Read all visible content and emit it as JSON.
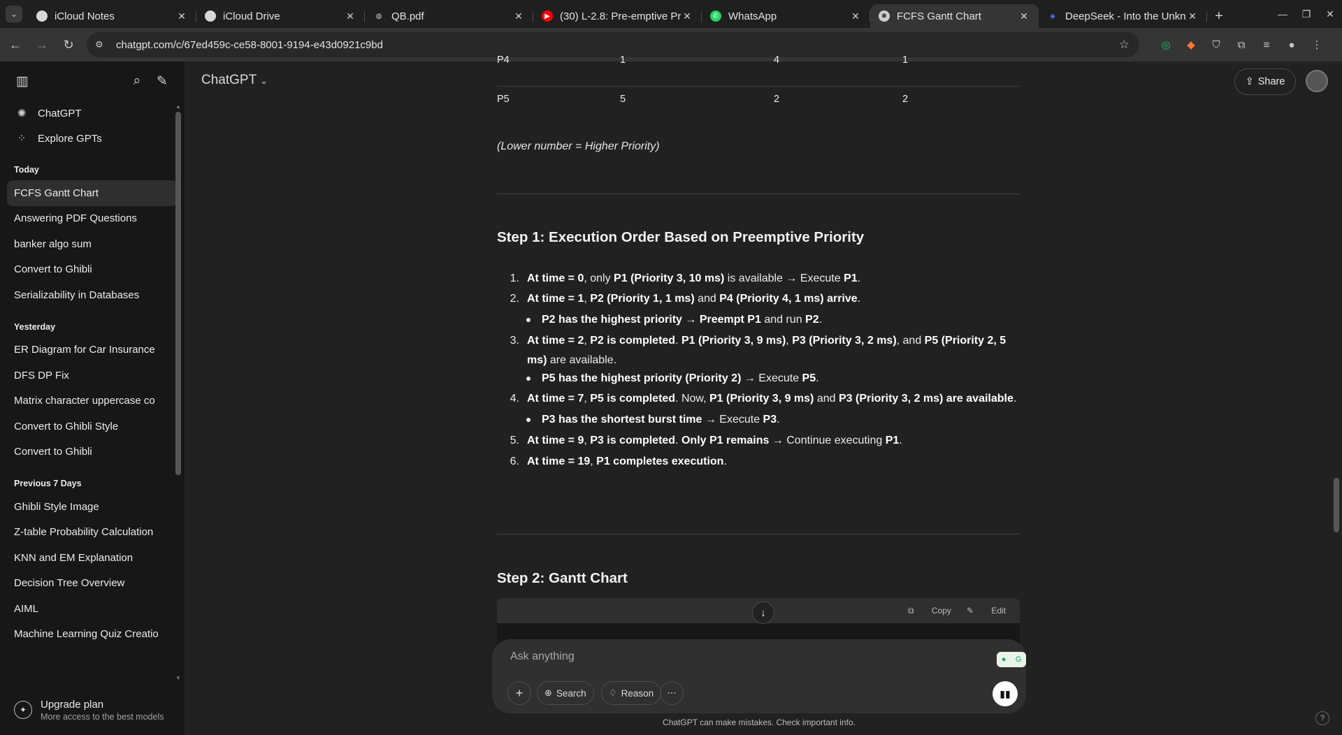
{
  "browser": {
    "tabs": [
      {
        "title": "iCloud Notes",
        "icon": "apple-icon",
        "active": false
      },
      {
        "title": "iCloud Drive",
        "icon": "apple-icon",
        "active": false
      },
      {
        "title": "QB.pdf",
        "icon": "globe-icon",
        "active": false
      },
      {
        "title": "(30) L-2.8: Pre-emptive Pr",
        "icon": "youtube-icon",
        "active": false
      },
      {
        "title": "WhatsApp",
        "icon": "whatsapp-icon",
        "active": false
      },
      {
        "title": "FCFS Gantt Chart",
        "icon": "chatgpt-icon",
        "active": true
      },
      {
        "title": "DeepSeek - Into the Unkn",
        "icon": "deepseek-icon",
        "active": false
      }
    ],
    "url": "chatgpt.com/c/67ed459c-ce58-8001-9194-e43d0921c9bd"
  },
  "sidebar": {
    "top_items": [
      {
        "label": "ChatGPT",
        "icon": "chatgpt-icon"
      },
      {
        "label": "Explore GPTs",
        "icon": "grid-icon"
      }
    ],
    "sections": [
      {
        "title": "Today",
        "items": [
          "FCFS Gantt Chart",
          "Answering PDF Questions",
          "banker algo sum",
          "Convert to Ghibli",
          "Serializability in Databases"
        ]
      },
      {
        "title": "Yesterday",
        "items": [
          "ER Diagram for Car Insurance",
          "DFS DP Fix",
          "Matrix character uppercase co",
          "Convert to Ghibli Style",
          "Convert to Ghibli"
        ]
      },
      {
        "title": "Previous 7 Days",
        "items": [
          "Ghibli Style Image",
          "Z-table Probability Calculation",
          "KNN and EM Explanation",
          "Decision Tree Overview",
          "AIML",
          "Machine Learning Quiz Creatio"
        ]
      }
    ],
    "active_item": "FCFS Gantt Chart",
    "upgrade": {
      "title": "Upgrade plan",
      "subtitle": "More access to the best models"
    }
  },
  "header": {
    "model": "ChatGPT",
    "share": "Share"
  },
  "table_rows": [
    {
      "process": "P4",
      "arrival": "1",
      "burst": "4",
      "priority": "1"
    },
    {
      "process": "P5",
      "arrival": "5",
      "burst": "2",
      "priority": "2"
    }
  ],
  "note": "(Lower number = Higher Priority)",
  "step1": {
    "title": "Step 1: Execution Order Based on Preemptive Priority",
    "items": [
      {
        "num": "1.",
        "html": "<b>At time = 0</b>, only <b>P1 (Priority 3, 10 ms)</b> is available → Execute <b>P1</b>."
      },
      {
        "num": "2.",
        "html": "<b>At time = 1</b>, <b>P2 (Priority 1, 1 ms)</b> and <b>P4 (Priority 4, 1 ms) arrive</b>."
      },
      {
        "num": "•",
        "html": "<b>P2 has the highest priority</b> → <b>Preempt P1</b> and run <b>P2</b>."
      },
      {
        "num": "3.",
        "html": "<b>At time = 2</b>, <b>P2 is completed</b>. <b>P1 (Priority 3, 9 ms)</b>, <b>P3 (Priority 3, 2 ms)</b>, and <b>P5 (Priority 2, 5 ms)</b> are available."
      },
      {
        "num": "•",
        "html": "<b>P5 has the highest priority (Priority 2)</b> → Execute <b>P5</b>."
      },
      {
        "num": "4.",
        "html": "<b>At time = 7</b>, <b>P5 is completed</b>. Now, <b>P1 (Priority 3, 9 ms)</b> and <b>P3 (Priority 3, 2 ms) are available</b>."
      },
      {
        "num": "•",
        "html": "<b>P3 has the shortest burst time</b> → Execute <b>P3</b>."
      },
      {
        "num": "5.",
        "html": "<b>At time = 9</b>, <b>P3 is completed</b>. <b>Only P1 remains</b> → Continue executing <b>P1</b>."
      },
      {
        "num": "6.",
        "html": "<b>At time = 19</b>, <b>P1 completes execution</b>."
      }
    ]
  },
  "step2": {
    "title": "Step 2: Gantt Chart",
    "copy": "Copy",
    "edit": "Edit"
  },
  "composer": {
    "placeholder": "Ask anything",
    "search": "Search",
    "reason": "Reason"
  },
  "disclaimer": "ChatGPT can make mistakes. Check important info."
}
